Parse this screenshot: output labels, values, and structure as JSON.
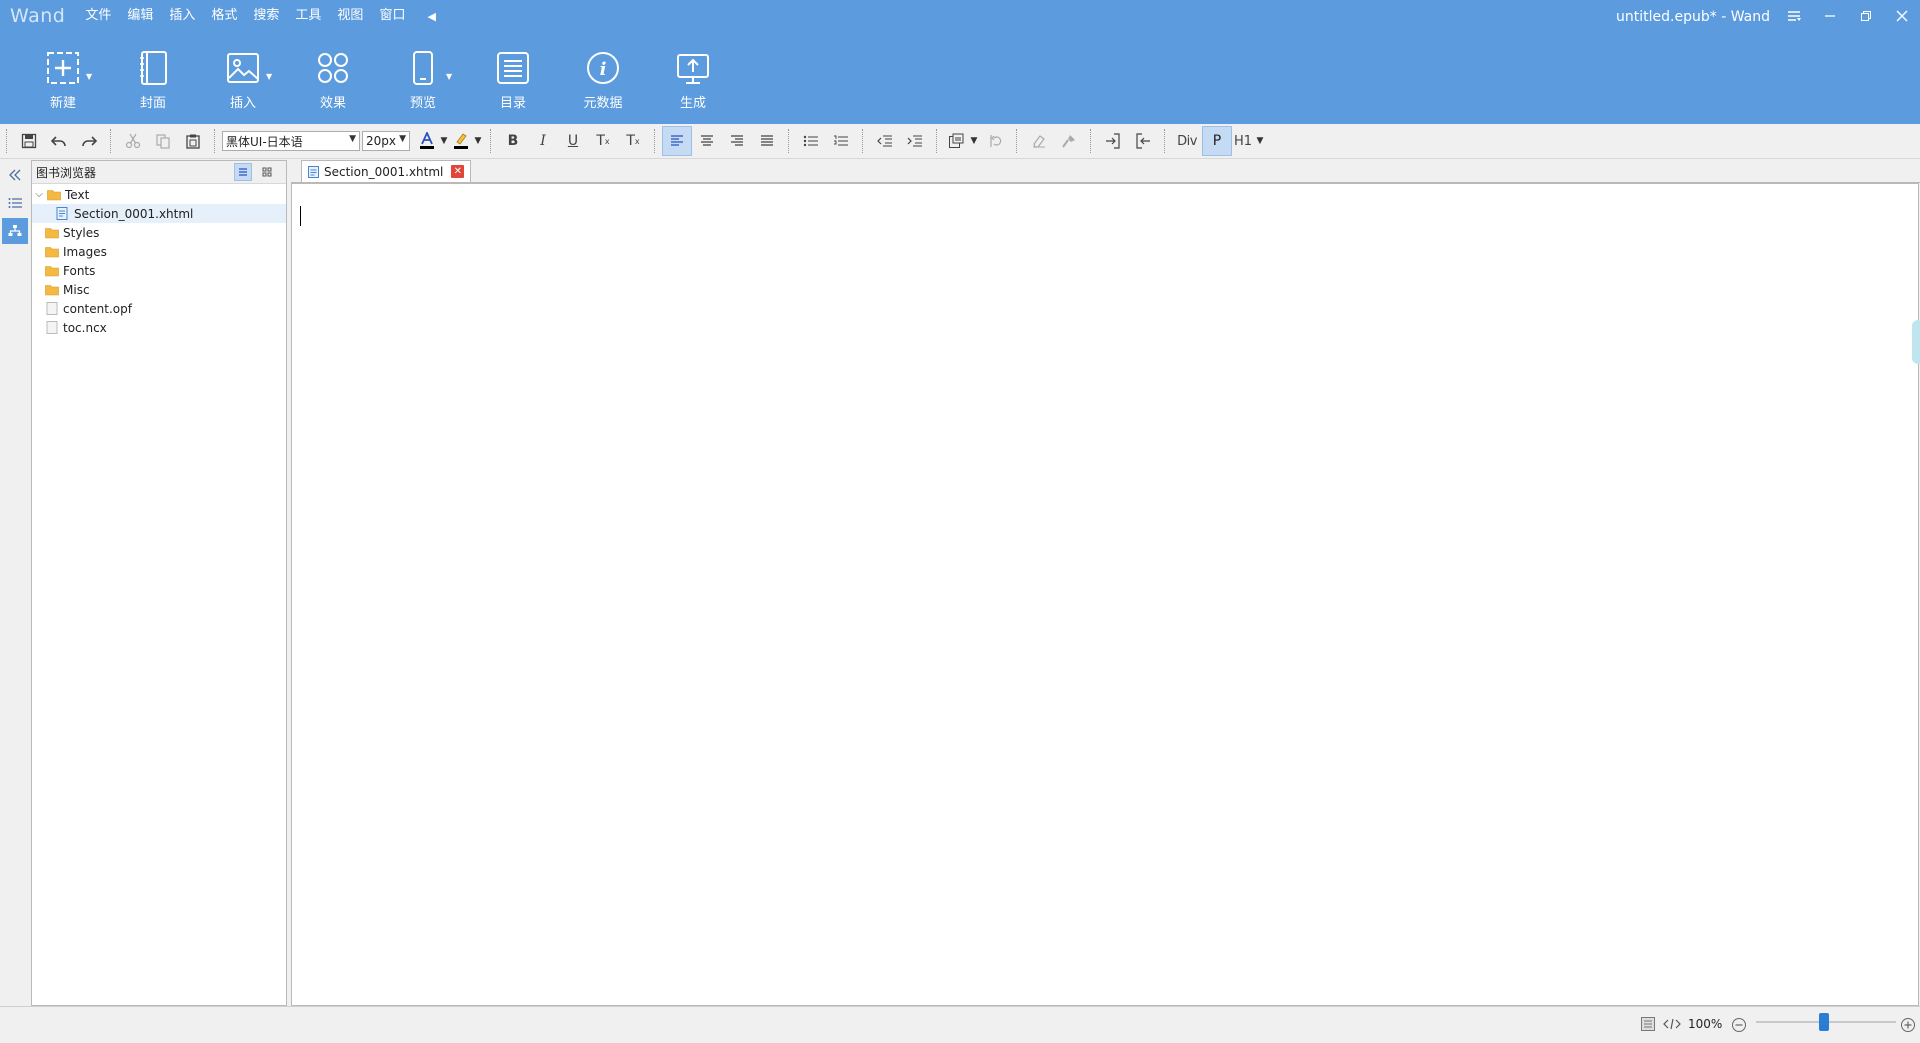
{
  "app": {
    "name": "Wand",
    "window_title": "untitled.epub* - Wand"
  },
  "menu": [
    "文件",
    "编辑",
    "插入",
    "格式",
    "搜索",
    "工具",
    "视图",
    "窗口"
  ],
  "ribbon": [
    {
      "label": "新建",
      "icon": "new-section-icon",
      "dropdown": true
    },
    {
      "label": "封面",
      "icon": "cover-icon",
      "dropdown": false
    },
    {
      "label": "插入",
      "icon": "image-icon",
      "dropdown": true
    },
    {
      "label": "效果",
      "icon": "effects-icon",
      "dropdown": false
    },
    {
      "label": "预览",
      "icon": "phone-icon",
      "dropdown": true
    },
    {
      "label": "目录",
      "icon": "toc-icon",
      "dropdown": false
    },
    {
      "label": "元数据",
      "icon": "info-icon",
      "dropdown": false
    },
    {
      "label": "生成",
      "icon": "export-icon",
      "dropdown": false
    }
  ],
  "toolbar": {
    "font_family": "黑体UI-日本语",
    "font_size": "20px",
    "div_label": "Div",
    "p_label": "P",
    "h1_label": "H1"
  },
  "browser": {
    "title": "图书浏览器",
    "tree": [
      {
        "label": "Text",
        "type": "folder",
        "expanded": true,
        "level": 0
      },
      {
        "label": "Section_0001.xhtml",
        "type": "xhtml",
        "level": 1,
        "selected": true
      },
      {
        "label": "Styles",
        "type": "folder",
        "level": 0
      },
      {
        "label": "Images",
        "type": "folder",
        "level": 0
      },
      {
        "label": "Fonts",
        "type": "folder",
        "level": 0
      },
      {
        "label": "Misc",
        "type": "folder",
        "level": 0
      },
      {
        "label": "content.opf",
        "type": "file",
        "level": 0
      },
      {
        "label": "toc.ncx",
        "type": "file",
        "level": 0
      }
    ]
  },
  "editor": {
    "tab_label": "Section_0001.xhtml"
  },
  "status": {
    "zoom": "100%"
  },
  "colors": {
    "accent": "#5b9bde",
    "close": "#e0463a",
    "slider": "#2b7cd3"
  }
}
